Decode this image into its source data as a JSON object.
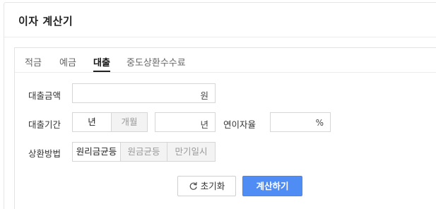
{
  "app": {
    "title": "이자 계산기"
  },
  "tabs": [
    {
      "label": "적금"
    },
    {
      "label": "예금"
    },
    {
      "label": "대출"
    },
    {
      "label": "중도상환수수료"
    }
  ],
  "active_tab": "대출",
  "form": {
    "amount": {
      "label": "대출금액",
      "value": "",
      "unit": "원"
    },
    "period": {
      "label": "대출기간",
      "options": [
        "년",
        "개월"
      ],
      "selected": "년",
      "value": "",
      "unit": "년"
    },
    "rate": {
      "label": "연이자율",
      "value": "",
      "unit": "%"
    },
    "method": {
      "label": "상환방법",
      "options": [
        "원리금균등",
        "원금균등",
        "만기일시"
      ],
      "selected": "원리금균등"
    }
  },
  "buttons": {
    "reset": "초기화",
    "calculate": "계산하기"
  },
  "colors": {
    "accent": "#4f8df5",
    "border": "#d6d6d6",
    "inactive_bg": "#f3f3f3"
  }
}
